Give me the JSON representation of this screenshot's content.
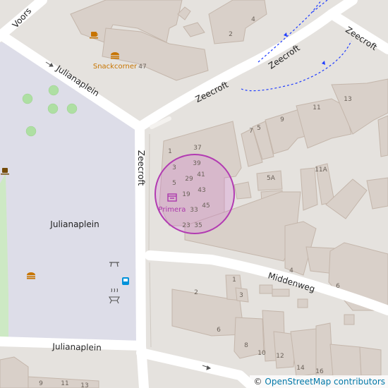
{
  "map": {
    "streets": [
      {
        "name": "Voorst",
        "label": "Voors"
      },
      {
        "name": "Julianaplein-north",
        "label": "Julianaplein"
      },
      {
        "name": "Julianaplein-south",
        "label": "Julianaplein"
      },
      {
        "name": "Zeecroft-west",
        "label": "Zeecroft"
      },
      {
        "name": "Zeecroft-north",
        "label": "Zeecroft"
      },
      {
        "name": "Zeecroft-mid",
        "label": "Zeecroft"
      },
      {
        "name": "Zeecroft-east",
        "label": "Zeecroft"
      },
      {
        "name": "Middenweg",
        "label": "Middenweg"
      }
    ],
    "places": {
      "park": "Julianaplein"
    },
    "pois": {
      "snackcorner": "Snackcorner",
      "primera": "Primera"
    },
    "house_numbers": [
      "47",
      "4",
      "2",
      "1",
      "37",
      "39",
      "3",
      "41",
      "5",
      "29",
      "43",
      "19",
      "45",
      "33",
      "23",
      "35",
      "7",
      "5",
      "9",
      "11",
      "13",
      "5A",
      "11A",
      "1",
      "3",
      "2",
      "6",
      "4",
      "6",
      "8",
      "10",
      "12",
      "14",
      "16",
      "9",
      "11",
      "13"
    ],
    "colors": {
      "park": "#dddde8",
      "building": "#d9d0c9",
      "road": "#ffffff",
      "footway": "#1e3cff",
      "highlight": "#b23bb2",
      "poi_food": "#c77400",
      "poi_shop": "#ac39ac",
      "bus": "#0092da",
      "tree": "#aedfa3"
    },
    "icons": [
      "cafe-icon",
      "fast-food-icon",
      "fast-food-icon",
      "shop-icon",
      "cafe-icon",
      "picnic-table-icon",
      "bus-stop-icon",
      "bbq-icon"
    ]
  },
  "attribution": {
    "prefix": "©",
    "link": "OpenStreetMap contributors"
  }
}
